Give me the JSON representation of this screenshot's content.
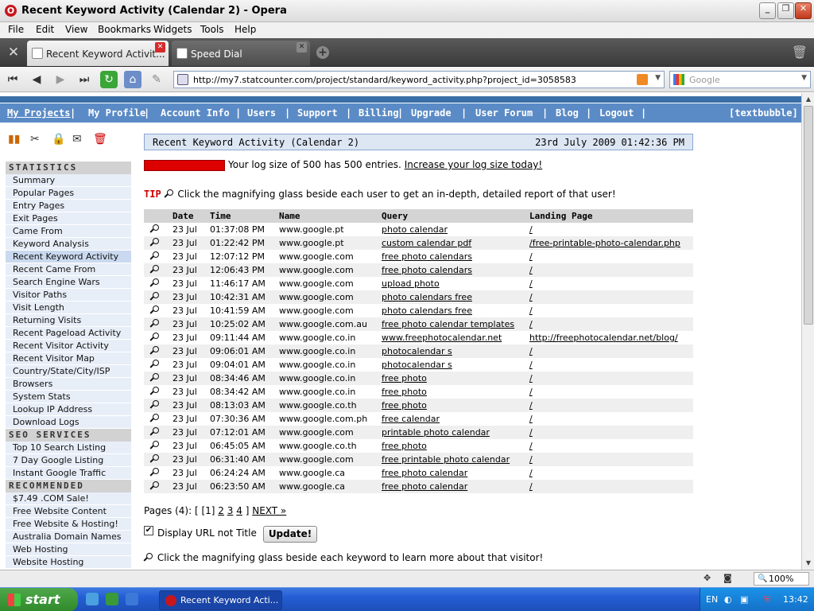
{
  "window": {
    "title": "Recent Keyword Activity (Calendar 2) - Opera"
  },
  "menu": [
    "File",
    "Edit",
    "View",
    "Bookmarks",
    "Widgets",
    "Tools",
    "Help"
  ],
  "tabs": [
    {
      "label": "Recent Keyword Activit..."
    },
    {
      "label": "Speed Dial"
    }
  ],
  "address": {
    "url": "http://my7.statcounter.com/project/standard/keyword_activity.php?project_id=3058583",
    "search_placeholder": "Google"
  },
  "sitenav": {
    "items": [
      "My Projects",
      "My Profile",
      "Account Info",
      "Users",
      "Support",
      "Billing",
      "Upgrade",
      "User Forum",
      "Blog",
      "Logout"
    ],
    "right": "[textbubble]"
  },
  "sidebar": {
    "statistics_head": "STATISTICS",
    "statistics": [
      "Summary",
      "Popular Pages",
      "Entry Pages",
      "Exit Pages",
      "Came From",
      "Keyword Analysis",
      "Recent Keyword Activity",
      "Recent Came From",
      "Search Engine Wars",
      "Visitor Paths",
      "Visit Length",
      "Returning Visits",
      "Recent Pageload Activity",
      "Recent Visitor Activity",
      "Recent Visitor Map",
      "Country/State/City/ISP",
      "Browsers",
      "System Stats",
      "Lookup IP Address",
      "Download Logs"
    ],
    "seo_head": "SEO SERVICES",
    "seo": [
      "Top 10 Search Listing",
      "7 Day Google Listing",
      "Instant Google Traffic"
    ],
    "rec_head": "RECOMMENDED",
    "recommended": [
      "$7.49 .COM Sale!",
      "Free Website Content",
      "Free Website & Hosting!",
      "Australia Domain Names",
      "Web Hosting",
      "Website Hosting"
    ]
  },
  "main": {
    "title": "Recent Keyword Activity (Calendar 2)",
    "datetime": "23rd July 2009 01:42:36 PM",
    "log_text": "Your log size of 500 has 500 entries.",
    "log_link": "Increase your log size today!",
    "tip_label": "TIP",
    "tip_text": "Click the magnifying glass beside each user to get an in-depth, detailed report of that user!",
    "columns": [
      "Date",
      "Time",
      "Name",
      "Query",
      "Landing Page"
    ],
    "rows": [
      {
        "date": "23 Jul",
        "time": "01:37:08 PM",
        "name": "www.google.pt",
        "query": "photo calendar",
        "landing": "/"
      },
      {
        "date": "23 Jul",
        "time": "01:22:42 PM",
        "name": "www.google.pt",
        "query": "custom calendar pdf",
        "landing": "/free-printable-photo-calendar.php"
      },
      {
        "date": "23 Jul",
        "time": "12:07:12 PM",
        "name": "www.google.com",
        "query": "free photo calendars",
        "landing": "/"
      },
      {
        "date": "23 Jul",
        "time": "12:06:43 PM",
        "name": "www.google.com",
        "query": "free photo calendars",
        "landing": "/"
      },
      {
        "date": "23 Jul",
        "time": "11:46:17 AM",
        "name": "www.google.com",
        "query": "upload photo",
        "landing": "/"
      },
      {
        "date": "23 Jul",
        "time": "10:42:31 AM",
        "name": "www.google.com",
        "query": "photo calendars free",
        "landing": "/"
      },
      {
        "date": "23 Jul",
        "time": "10:41:59 AM",
        "name": "www.google.com",
        "query": "photo calendars free",
        "landing": "/"
      },
      {
        "date": "23 Jul",
        "time": "10:25:02 AM",
        "name": "www.google.com.au",
        "query": "free photo calendar templates",
        "landing": "/"
      },
      {
        "date": "23 Jul",
        "time": "09:11:44 AM",
        "name": "www.google.co.in",
        "query": "www.freephotocalendar.net",
        "landing": "http://freephotocalendar.net/blog/"
      },
      {
        "date": "23 Jul",
        "time": "09:06:01 AM",
        "name": "www.google.co.in",
        "query": "photocalendar s",
        "landing": "/"
      },
      {
        "date": "23 Jul",
        "time": "09:04:01 AM",
        "name": "www.google.co.in",
        "query": "photocalendar s",
        "landing": "/"
      },
      {
        "date": "23 Jul",
        "time": "08:34:46 AM",
        "name": "www.google.co.in",
        "query": "free photo",
        "landing": "/"
      },
      {
        "date": "23 Jul",
        "time": "08:34:42 AM",
        "name": "www.google.co.in",
        "query": "free photo",
        "landing": "/"
      },
      {
        "date": "23 Jul",
        "time": "08:13:03 AM",
        "name": "www.google.co.th",
        "query": "free photo",
        "landing": "/"
      },
      {
        "date": "23 Jul",
        "time": "07:30:36 AM",
        "name": "www.google.com.ph",
        "query": "free calendar",
        "landing": "/"
      },
      {
        "date": "23 Jul",
        "time": "07:12:01 AM",
        "name": "www.google.com",
        "query": "printable photo calendar",
        "landing": "/"
      },
      {
        "date": "23 Jul",
        "time": "06:45:05 AM",
        "name": "www.google.co.th",
        "query": "free photo",
        "landing": "/"
      },
      {
        "date": "23 Jul",
        "time": "06:31:40 AM",
        "name": "www.google.com",
        "query": "free printable photo calendar",
        "landing": "/"
      },
      {
        "date": "23 Jul",
        "time": "06:24:24 AM",
        "name": "www.google.ca",
        "query": "free photo calendar",
        "landing": "/"
      },
      {
        "date": "23 Jul",
        "time": "06:23:50 AM",
        "name": "www.google.ca",
        "query": "free photo calendar",
        "landing": "/"
      }
    ],
    "pages_prefix": "Pages (4): [ [1]",
    "pages": [
      "2",
      "3",
      "4"
    ],
    "pages_sep": "]",
    "next": "NEXT »",
    "display_url_label": "Display URL not Title",
    "update_button": "Update!",
    "bottom_text": "Click the magnifying glass beside each keyword to learn more about that visitor!"
  },
  "statusbar": {
    "zoom": "100%"
  },
  "taskbar": {
    "start": "start",
    "item": "Recent Keyword Acti...",
    "lang": "EN",
    "clock": "13:42"
  }
}
